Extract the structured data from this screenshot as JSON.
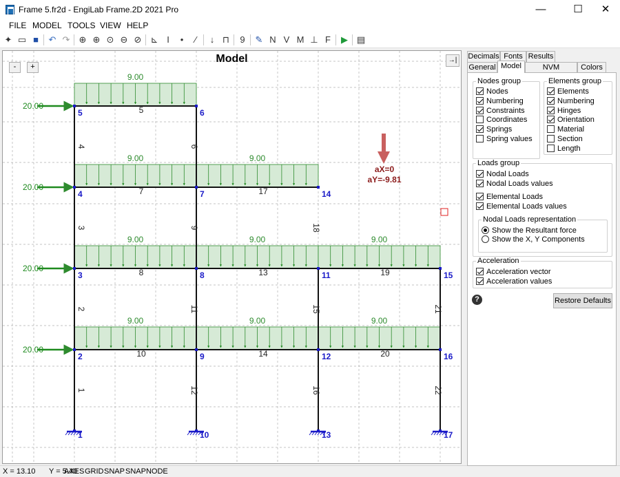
{
  "window": {
    "title": "Frame 5.fr2d - EngiLab Frame.2D 2021 Pro",
    "min": "—",
    "max": "☐",
    "close": "✕"
  },
  "menu": [
    "FILE",
    "MODEL",
    "TOOLS",
    "VIEW",
    "HELP"
  ],
  "toolbar": {
    "letters": [
      "N",
      "V",
      "M",
      "F"
    ],
    "nine": "9"
  },
  "canvas": {
    "title": "Model",
    "zoom_minus": "-",
    "zoom_plus": "+",
    "collapse_icon": "→|",
    "accel_x": "aX=0",
    "accel_y": "aY=-9.81",
    "nodal_loads": [
      "20.00",
      "20.00",
      "20.00",
      "20.00"
    ],
    "distributed_loads": [
      "9.00",
      "9.00",
      "9.00",
      "9.00",
      "9.00",
      "9.00",
      "9.00",
      "9.00",
      "9.00"
    ],
    "nodes": [
      "1",
      "2",
      "3",
      "4",
      "5",
      "6",
      "7",
      "8",
      "9",
      "10",
      "11",
      "12",
      "13",
      "14",
      "15",
      "16",
      "17"
    ],
    "elements": [
      "1",
      "2",
      "3",
      "4",
      "5",
      "6",
      "7",
      "8",
      "9",
      "10",
      "11",
      "12",
      "13",
      "14",
      "15",
      "16",
      "17",
      "18",
      "19",
      "20",
      "21",
      "22"
    ],
    "colors": {
      "grid": "#b0b0b0",
      "member": "#111111",
      "node_label": "#1a1ac8",
      "load_fill": "#d6ead6",
      "load_line": "#2e8b2e",
      "nodal_arrow": "#1e8a1e",
      "accel": "#8b1a1a",
      "accel_arrow": "#c9605f"
    }
  },
  "status": {
    "x": "X = 13.10",
    "y": "Y = 5.40",
    "flags": [
      "AXES",
      "GRID",
      "SNAP",
      "SNAPNODE"
    ]
  },
  "panel": {
    "tabs_row1": [
      "Decimals",
      "Fonts",
      "Results"
    ],
    "tabs_row2": [
      "General",
      "Model",
      "NVM Diagrams",
      "Colors"
    ],
    "active_tab": "Model",
    "nodes_group": {
      "title": "Nodes group",
      "items": [
        {
          "label": "Nodes",
          "checked": true
        },
        {
          "label": "Numbering",
          "checked": true
        },
        {
          "label": "Constraints",
          "checked": true
        },
        {
          "label": "Coordinates",
          "checked": false
        },
        {
          "label": "Springs",
          "checked": true
        },
        {
          "label": "Spring values",
          "checked": false
        }
      ]
    },
    "elements_group": {
      "title": "Elements group",
      "items": [
        {
          "label": "Elements",
          "checked": true
        },
        {
          "label": "Numbering",
          "checked": true
        },
        {
          "label": "Hinges",
          "checked": true
        },
        {
          "label": "Orientation",
          "checked": true
        },
        {
          "label": "Material",
          "checked": false
        },
        {
          "label": "Section",
          "checked": false
        },
        {
          "label": "Length",
          "checked": false
        }
      ]
    },
    "loads_group": {
      "title": "Loads group",
      "items": [
        {
          "label": "Nodal Loads",
          "checked": true
        },
        {
          "label": "Nodal Loads values",
          "checked": true
        },
        {
          "label": "Elemental Loads",
          "checked": true
        },
        {
          "label": "Elemental Loads values",
          "checked": true
        }
      ]
    },
    "nodal_repr": {
      "title": "Nodal Loads representation",
      "options": [
        {
          "label": "Show the Resultant force",
          "selected": true
        },
        {
          "label": "Show the X, Y Components",
          "selected": false
        }
      ]
    },
    "accel_group": {
      "title": "Acceleration",
      "items": [
        {
          "label": "Acceleration vector",
          "checked": true
        },
        {
          "label": "Acceleration values",
          "checked": true
        }
      ]
    },
    "help": "?",
    "restore": "Restore Defaults"
  }
}
